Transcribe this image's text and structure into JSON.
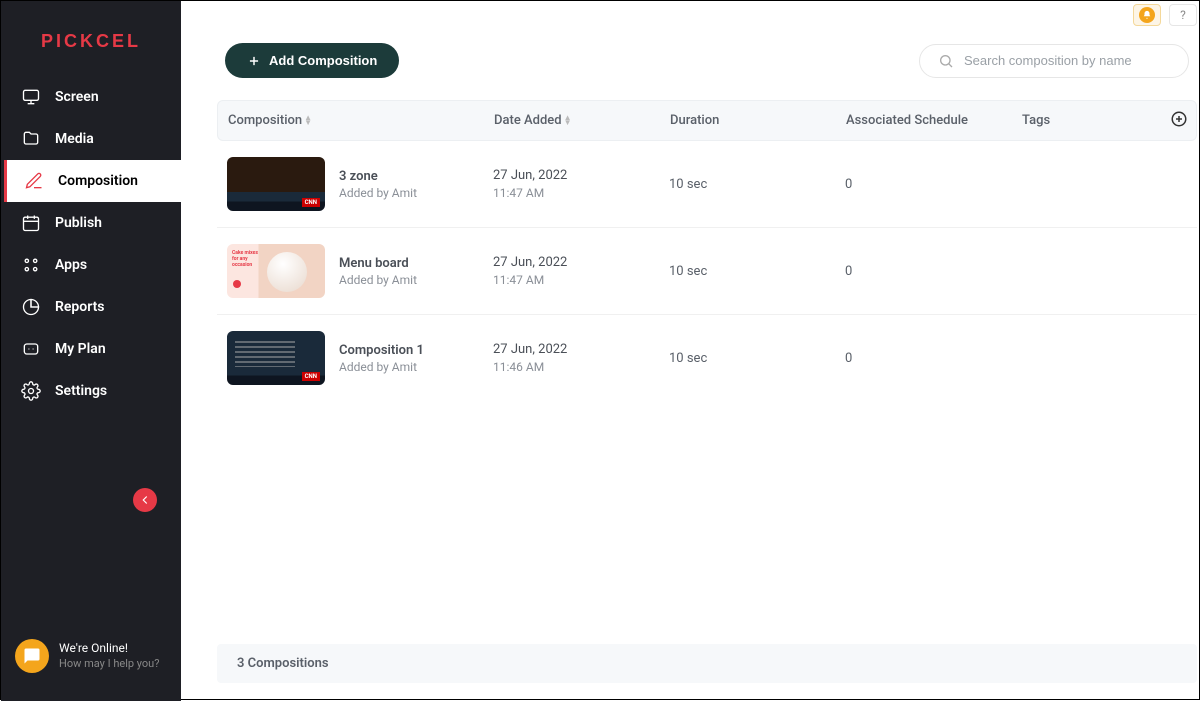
{
  "brand": "PICKCEL",
  "sidebar": {
    "items": [
      {
        "label": "Screen",
        "icon": "monitor-icon"
      },
      {
        "label": "Media",
        "icon": "folder-icon"
      },
      {
        "label": "Composition",
        "icon": "edit-icon"
      },
      {
        "label": "Publish",
        "icon": "calendar-icon"
      },
      {
        "label": "Apps",
        "icon": "grid-icon"
      },
      {
        "label": "Reports",
        "icon": "pie-icon"
      },
      {
        "label": "My Plan",
        "icon": "badge-icon"
      },
      {
        "label": "Settings",
        "icon": "gear-icon"
      }
    ],
    "active_index": 2
  },
  "topbar": {
    "help_label": "?"
  },
  "chat": {
    "online": "We're Online!",
    "help": "How may I help you?"
  },
  "actions": {
    "add_composition": "Add Composition",
    "search_placeholder": "Search composition by name"
  },
  "table": {
    "headers": {
      "composition": "Composition",
      "date_added": "Date Added",
      "duration": "Duration",
      "schedule": "Associated Schedule",
      "tags": "Tags"
    },
    "rows": [
      {
        "title": "3 zone",
        "added_by": "Added by Amit",
        "date": "27 Jun, 2022",
        "time": "11:47 AM",
        "duration": "10 sec",
        "schedule": "0"
      },
      {
        "title": "Menu board",
        "added_by": "Added by Amit",
        "date": "27 Jun, 2022",
        "time": "11:47 AM",
        "duration": "10 sec",
        "schedule": "0"
      },
      {
        "title": "Composition 1",
        "added_by": "Added by Amit",
        "date": "27 Jun, 2022",
        "time": "11:46 AM",
        "duration": "10 sec",
        "schedule": "0"
      }
    ],
    "footer_count": "3 Compositions"
  },
  "thumb2_overlay": "Cake mixes\nfor any\noccasion"
}
